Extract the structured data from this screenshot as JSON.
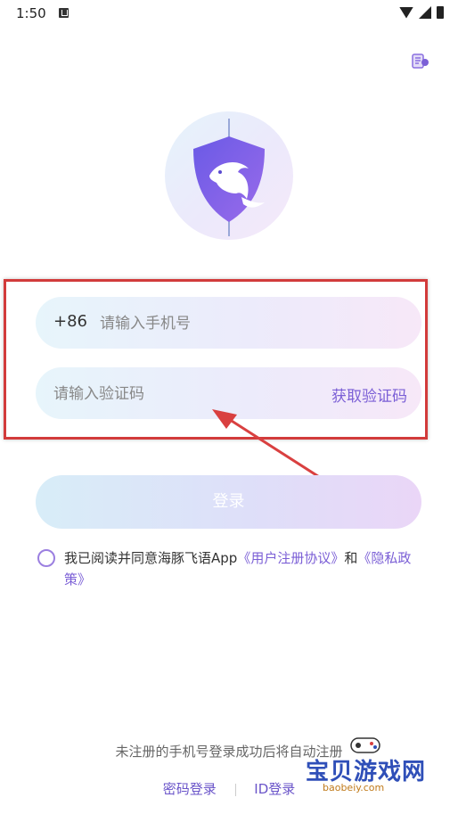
{
  "status_bar": {
    "time": "1:50"
  },
  "login": {
    "country_code": "+86",
    "phone_placeholder": "请输入手机号",
    "code_placeholder": "请输入验证码",
    "get_code_label": "获取验证码",
    "login_label": "登录"
  },
  "agreement": {
    "prefix": "我已阅读并同意海豚飞语App",
    "user_agreement": "《用户注册协议》",
    "and": "和",
    "privacy": "《隐私政策》"
  },
  "footer": {
    "note": "未注册的手机号登录成功后将自动注册",
    "password_login": "密码登录",
    "id_login": "ID登录"
  },
  "watermark": {
    "text": "宝贝游戏网",
    "url": "baobeiy.com"
  },
  "colors": {
    "accent": "#7b5fd6",
    "highlight_box": "#d23b3b",
    "arrow": "#d94040"
  }
}
